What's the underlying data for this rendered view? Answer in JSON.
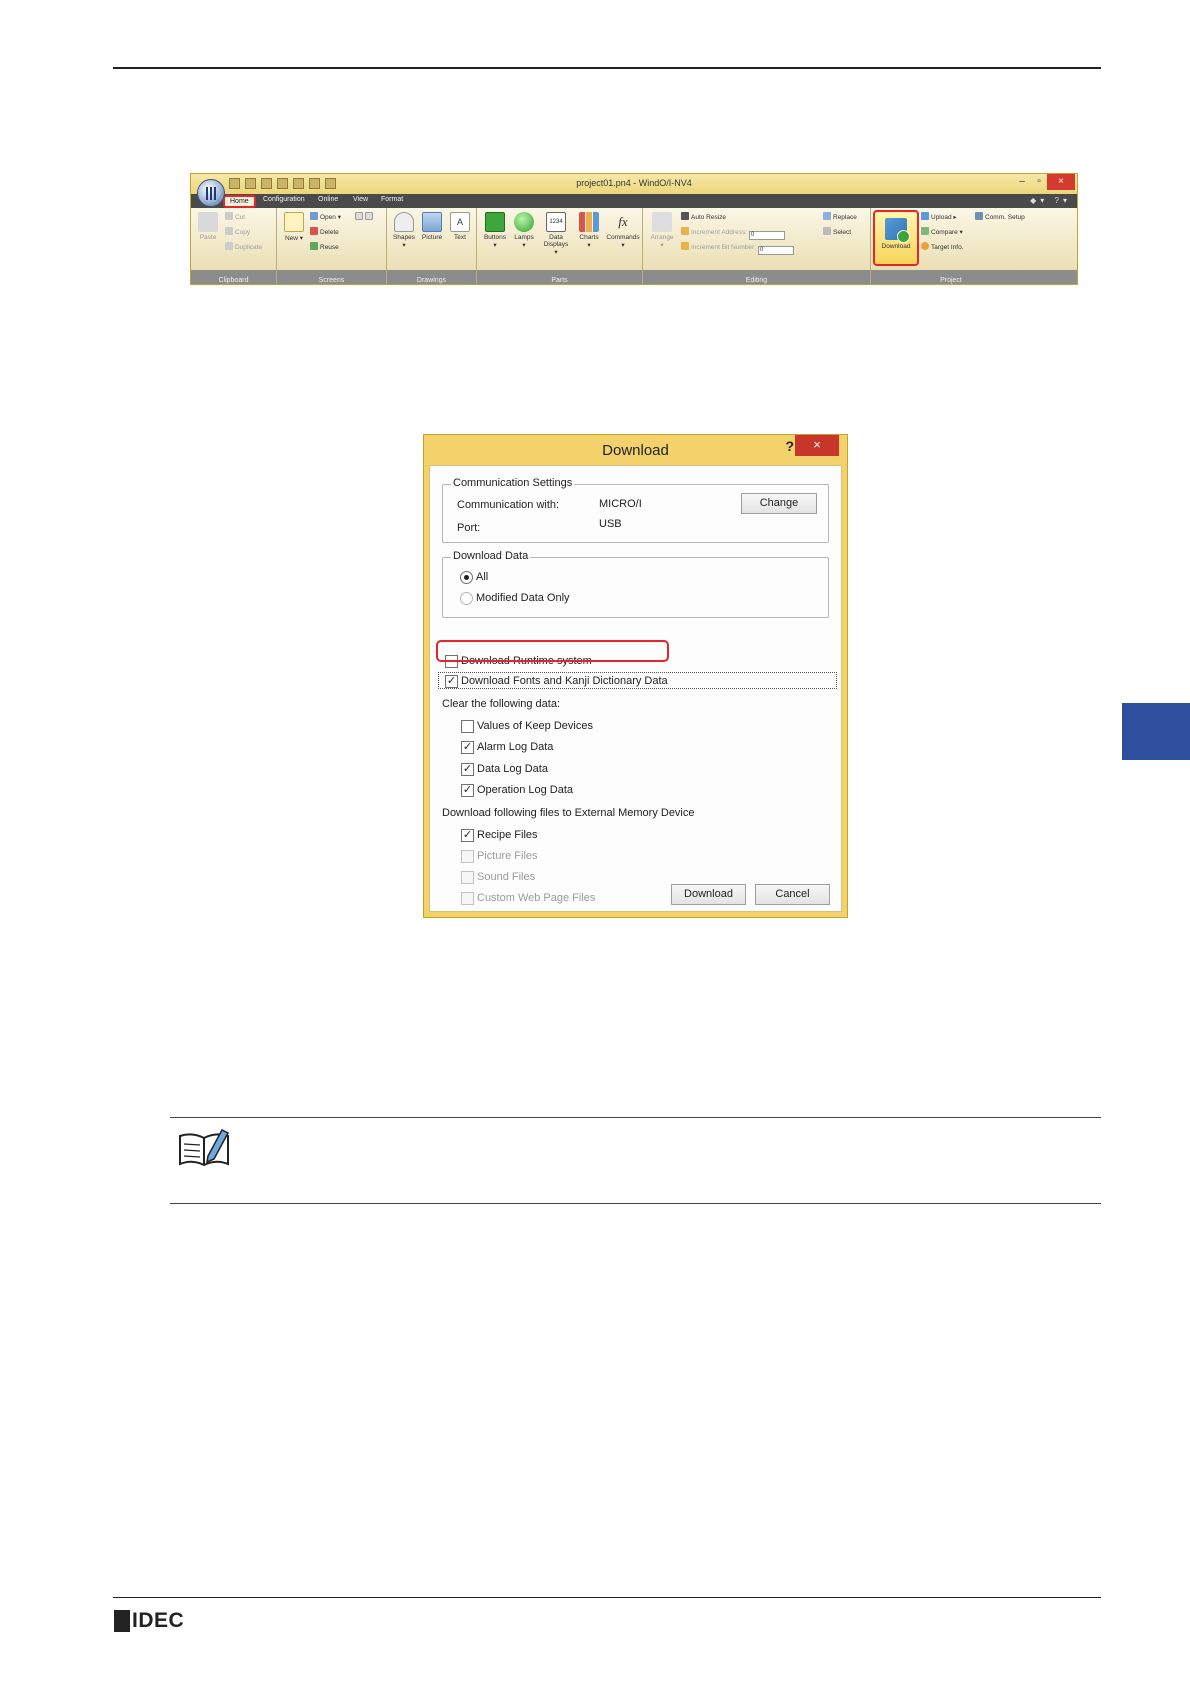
{
  "ribbon": {
    "window_title": "project01.pn4 - WindO/I-NV4",
    "tabs": [
      "Home",
      "Configuration",
      "Online",
      "View",
      "Format"
    ],
    "groups": {
      "clipboard": {
        "label": "Clipboard",
        "paste": "Paste",
        "cut": "Cut",
        "copy": "Copy",
        "duplicate": "Duplicate"
      },
      "screens": {
        "label": "Screens",
        "new": "New",
        "open": "Open",
        "delete": "Delete",
        "reuse": "Reuse"
      },
      "drawings": {
        "label": "Drawings",
        "shapes": "Shapes",
        "picture": "Picture",
        "text": "Text"
      },
      "parts": {
        "label": "Parts",
        "buttons": "Buttons",
        "lamps": "Lamps",
        "data_displays": "Data Displays",
        "data_displays_icon": "1234",
        "charts": "Charts",
        "commands": "Commands",
        "commands_icon": "fx"
      },
      "editing": {
        "label": "Editing",
        "arrange": "Arrange",
        "auto_resize": "Auto Resize",
        "increment_address": "Increment Address:",
        "increment_address_value": "0",
        "increment_bit_number": "Increment Bit Number:",
        "increment_bit_value": "0",
        "replace": "Replace",
        "select": "Select"
      },
      "project": {
        "label": "Project",
        "download": "Download",
        "upload": "Upload",
        "compare": "Compare",
        "target_info": "Target Info.",
        "comm_setup": "Comm. Setup"
      }
    }
  },
  "dialog": {
    "title": "Download",
    "help": "?",
    "close": "×",
    "comm_settings": {
      "legend": "Communication Settings",
      "with_label": "Communication with:",
      "with_value": "MICRO/I",
      "port_label": "Port:",
      "port_value": "USB",
      "change": "Change"
    },
    "download_data": {
      "legend": "Download Data",
      "all": "All",
      "modified": "Modified Data Only"
    },
    "runtime": "Download Runtime system",
    "fonts": "Download Fonts and Kanji Dictionary Data",
    "clear_label": "Clear the following data:",
    "clear_items": [
      "Values of Keep Devices",
      "Alarm Log Data",
      "Data Log Data",
      "Operation Log Data"
    ],
    "external_label": "Download following files to External Memory Device",
    "external_items": [
      "Recipe Files",
      "Picture Files",
      "Sound Files",
      "Custom Web Page Files"
    ],
    "download_btn": "Download",
    "cancel_btn": "Cancel"
  },
  "footer": {
    "logo": "IDEC"
  }
}
